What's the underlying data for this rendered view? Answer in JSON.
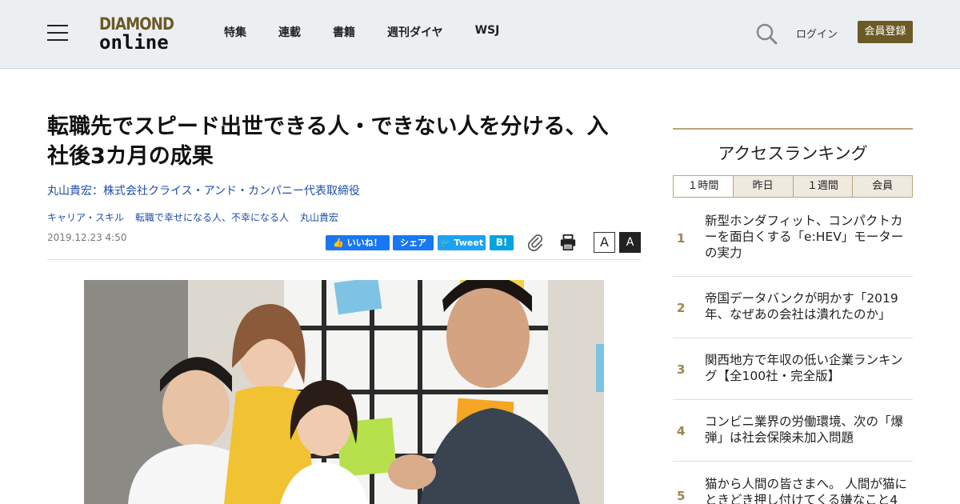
{
  "header": {
    "logo_line1": "DIAMOND",
    "logo_line2": "online",
    "nav": [
      "特集",
      "連載",
      "書籍",
      "週刊ダイヤ",
      "WSJ"
    ],
    "login_label": "ログイン",
    "register_label": "会員登録",
    "brand_color": "#6b5a25"
  },
  "article": {
    "title": "転職先でスピード出世できる人・できない人を分ける、入社後3カ月の成果",
    "author": "丸山貴宏：株式会社クライス・アンド・カンパニー代表取締役",
    "tags": [
      "キャリア・スキル",
      "転職で幸せになる人、不幸になる人",
      "丸山貴宏"
    ],
    "date": "2019.12.23 4:50",
    "social": {
      "like": "いいね！",
      "share": "シェア",
      "tweet": "Tweet",
      "hatena": "B!"
    },
    "font_small": "A",
    "font_large": "A"
  },
  "ranking": {
    "title": "アクセスランキング",
    "tabs": [
      "１時間",
      "昨日",
      "１週間",
      "会員"
    ],
    "items": [
      {
        "rank": "1",
        "text": "新型ホンダフィット、コンパクトカーを面白くする「e:HEV」モーターの実力"
      },
      {
        "rank": "2",
        "text": "帝国データバンクが明かす「2019年、なぜあの会社は潰れたのか」"
      },
      {
        "rank": "3",
        "text": "関西地方で年収の低い企業ランキング【全100社・完全版】"
      },
      {
        "rank": "4",
        "text": "コンビニ業界の労働環境、次の「爆弾」は社会保険未加入問題"
      },
      {
        "rank": "5",
        "text": "猫から人間の皆さまへ。 人間が猫にときどき押し付けてくる嫌なこと4"
      }
    ]
  }
}
